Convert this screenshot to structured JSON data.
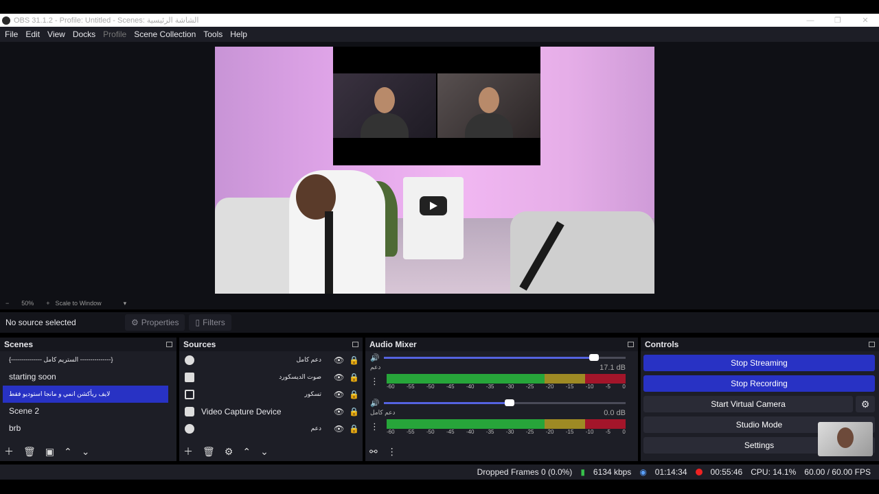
{
  "window": {
    "title": "OBS 31.1.2 - Profile: Untitled - Scenes: الشاشة الرئيسية",
    "minimize": "—",
    "maximize": "❐",
    "close": "✕"
  },
  "menu": {
    "file": "File",
    "edit": "Edit",
    "view": "View",
    "docks": "Docks",
    "profile": "Profile",
    "scene_collection": "Scene Collection",
    "tools": "Tools",
    "help": "Help"
  },
  "zoom": {
    "minus": "−",
    "level": "50%",
    "plus": "+",
    "mode": "Scale to Window",
    "dropdown": "▾"
  },
  "context": {
    "no_source": "No source selected",
    "properties": "Properties",
    "filters": "Filters"
  },
  "scenes": {
    "title": "Scenes",
    "items": [
      "{--------------- الستريم كامل ---------------}",
      "starting soon",
      "لايف ريأكشن انمي و مانجا  استوديو فقط",
      "Scene 2",
      "brb"
    ]
  },
  "sources": {
    "title": "Sources",
    "items": [
      "دعم كامل",
      "صوت الديسكورد",
      "تسكور",
      "Video Capture Device",
      "دعم"
    ]
  },
  "mixer": {
    "title": "Audio Mixer",
    "channels": [
      {
        "name": "دعم",
        "db": "17.1 dB",
        "volume": 0.87
      },
      {
        "name": "دعم كامل",
        "db": "0.0 dB",
        "volume": 0.52
      }
    ],
    "ticks": [
      "-60",
      "-55",
      "-50",
      "-45",
      "-40",
      "-35",
      "-30",
      "-25",
      "-20",
      "-15",
      "-10",
      "-5",
      "0"
    ]
  },
  "controls": {
    "title": "Controls",
    "stop_streaming": "Stop Streaming",
    "stop_recording": "Stop Recording",
    "start_virtual_camera": "Start Virtual Camera",
    "studio_mode": "Studio Mode",
    "settings": "Settings"
  },
  "status": {
    "dropped_frames": "Dropped Frames 0 (0.0%)",
    "bitrate": "6134 kbps",
    "stream_time": "01:14:34",
    "rec_time": "00:55:46",
    "cpu": "CPU: 14.1%",
    "fps": "60.00 / 60.00 FPS"
  },
  "colors": {
    "accent": "#2832c4",
    "panel": "#1d1e26",
    "meter_green": "#27a53a",
    "meter_yellow": "#9e8a24",
    "meter_red": "#a3152a"
  }
}
